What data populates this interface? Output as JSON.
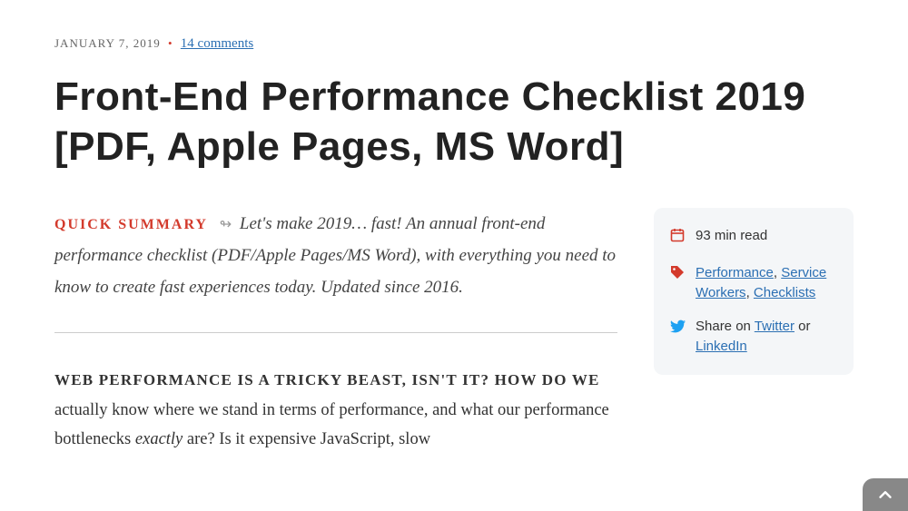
{
  "meta": {
    "date": "January 7, 2019",
    "comments_label": "14 comments"
  },
  "title": "Front-End Performance Checklist 2019 [PDF, Apple Pages, MS Word]",
  "summary": {
    "label": "Quick Summary",
    "arrow": "↬",
    "text": "Let's make 2019… fast! An annual front-end performance checklist (PDF/Apple Pages/MS Word), with everything you need to know to create fast experiences today. Updated since 2016."
  },
  "body": {
    "lead": "Web performance is a tricky beast, isn't it? How do we",
    "rest_1": " actually know where we stand in terms of performance, and what our performance bottlenecks ",
    "em": "exactly",
    "rest_2": " are? Is it expensive JavaScript, slow"
  },
  "sidebar": {
    "read_time": "93 min read",
    "tags": {
      "performance": "Performance",
      "sep1": ", ",
      "service_workers": "Service Workers",
      "sep2": ", ",
      "checklists": "Checklists"
    },
    "share": {
      "prefix": "Share on ",
      "twitter": "Twitter",
      "or": " or ",
      "linkedin": "LinkedIn"
    }
  }
}
